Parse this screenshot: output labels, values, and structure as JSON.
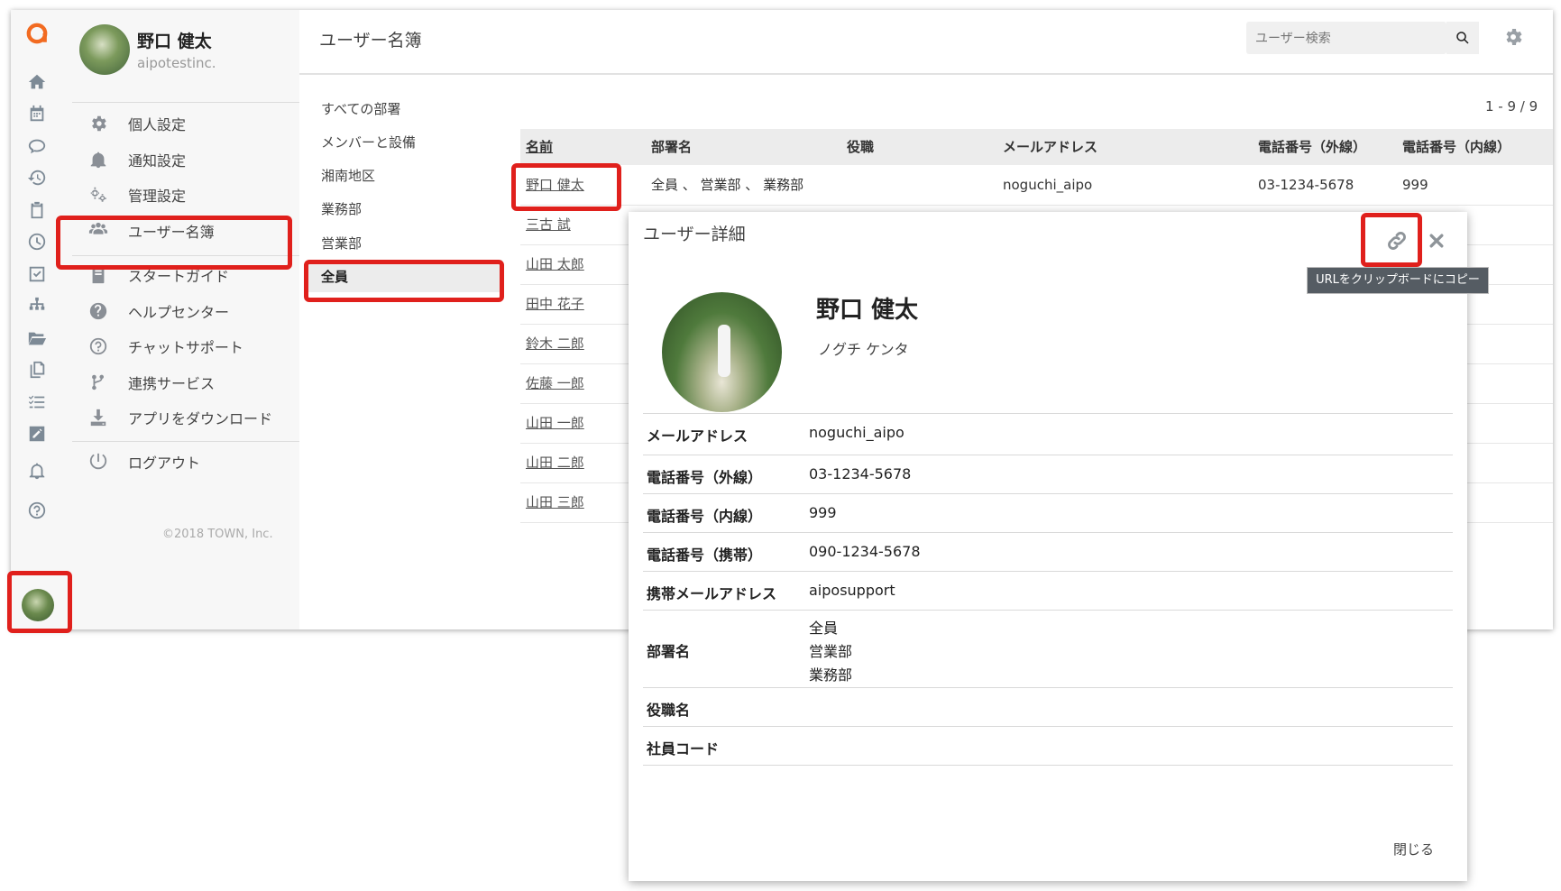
{
  "user": {
    "name": "野口 健太",
    "company": "aipotestinc."
  },
  "menu": {
    "items": [
      {
        "label": "個人設定",
        "icon": "gear-icon"
      },
      {
        "label": "通知設定",
        "icon": "bell-icon"
      },
      {
        "label": "管理設定",
        "icon": "gears-icon"
      },
      {
        "label": "ユーザー名簿",
        "icon": "users-icon"
      },
      {
        "label": "スタートガイド",
        "icon": "book-icon"
      },
      {
        "label": "ヘルプセンター",
        "icon": "question-circle-icon"
      },
      {
        "label": "チャットサポート",
        "icon": "question-outline-icon"
      },
      {
        "label": "連携サービス",
        "icon": "branch-icon"
      },
      {
        "label": "アプリをダウンロード",
        "icon": "download-icon"
      },
      {
        "label": "ログアウト",
        "icon": "power-icon"
      }
    ],
    "copyright": "©2018 TOWN, Inc."
  },
  "header": {
    "title": "ユーザー名簿",
    "search_placeholder": "ユーザー検索"
  },
  "groups": [
    "すべての部署",
    "メンバーと設備",
    "湘南地区",
    "業務部",
    "営業部",
    "全員"
  ],
  "pagination": "1 - 9 / 9",
  "table": {
    "columns": [
      "名前",
      "部署名",
      "役職",
      "メールアドレス",
      "電話番号（外線）",
      "電話番号（内線）"
    ],
    "first_row": {
      "name": "野口 健太",
      "dept": "全員 、 営業部 、 業務部",
      "email": "noguchi_aipo",
      "phone_ext": "03-1234-5678",
      "phone_int": "999"
    },
    "names": [
      "三古 試",
      "山田 太郎",
      "田中 花子",
      "鈴木 二郎",
      "佐藤 一郎",
      "山田 一郎",
      "山田 二郎",
      "山田 三郎"
    ]
  },
  "modal": {
    "title": "ユーザー詳細",
    "tooltip": "URLをクリップボードにコピー",
    "name": "野口 健太",
    "kana": "ノグチ ケンタ",
    "fields": {
      "email_label": "メールアドレス",
      "email": "noguchi_aipo",
      "phone_ext_label": "電話番号（外線）",
      "phone_ext": "03-1234-5678",
      "phone_int_label": "電話番号（内線）",
      "phone_int": "999",
      "phone_mobile_label": "電話番号（携帯）",
      "phone_mobile": "090-1234-5678",
      "mobile_email_label": "携帯メールアドレス",
      "mobile_email": "aiposupport",
      "dept_label": "部署名",
      "depts": [
        "全員",
        "営業部",
        "業務部"
      ],
      "position_label": "役職名",
      "employee_code_label": "社員コード"
    },
    "close_label": "閉じる"
  },
  "colors": {
    "highlight": "#e0201c",
    "logo": "#f26b21"
  }
}
